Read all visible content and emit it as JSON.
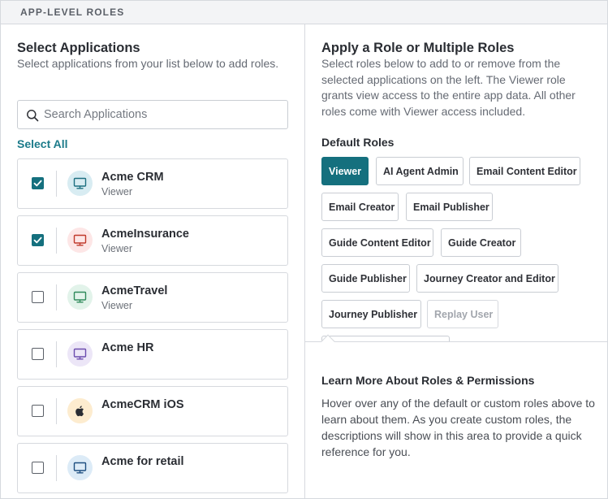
{
  "header": {
    "title": "APP-LEVEL ROLES"
  },
  "left": {
    "title": "Select Applications",
    "description": "Select applications from your list below to add roles.",
    "search": {
      "placeholder": "Search Applications",
      "value": ""
    },
    "select_all_label": "Select All",
    "apps": [
      {
        "name": "Acme CRM",
        "role": "Viewer",
        "checked": true,
        "icon": "monitor-icon",
        "avatar_bg": "#d8ecf2",
        "icon_color": "#1c6f80"
      },
      {
        "name": "AcmeInsurance",
        "role": "Viewer",
        "checked": true,
        "icon": "monitor-icon",
        "avatar_bg": "#fde6e6",
        "icon_color": "#c0392b"
      },
      {
        "name": "AcmeTravel",
        "role": "Viewer",
        "checked": false,
        "icon": "monitor-icon",
        "avatar_bg": "#e2f3ea",
        "icon_color": "#2e8a5a"
      },
      {
        "name": "Acme HR",
        "role": "",
        "checked": false,
        "icon": "monitor-icon",
        "avatar_bg": "#ece6f7",
        "icon_color": "#6b4cae"
      },
      {
        "name": "AcmeCRM iOS",
        "role": "",
        "checked": false,
        "icon": "apple-icon",
        "avatar_bg": "#fdeccf",
        "icon_color": "#2a2d33"
      },
      {
        "name": "Acme for retail",
        "role": "",
        "checked": false,
        "icon": "monitor-icon",
        "avatar_bg": "#dcebf7",
        "icon_color": "#1c4e80"
      }
    ]
  },
  "right": {
    "title": "Apply a Role or Multiple Roles",
    "description": "Select roles below to add to or remove from the selected applications on the left. The Viewer role grants view access to the entire app data. All other roles come with Viewer access included.",
    "default_roles_label": "Default Roles",
    "roles": [
      {
        "label": "Viewer",
        "state": "active"
      },
      {
        "label": "AI Agent Admin",
        "state": "normal"
      },
      {
        "label": "Email Content Editor",
        "state": "normal"
      },
      {
        "label": "Email Creator",
        "state": "normal"
      },
      {
        "label": "Email Publisher",
        "state": "normal"
      },
      {
        "label": "Guide Content Editor",
        "state": "normal"
      },
      {
        "label": "Guide Creator",
        "state": "normal"
      },
      {
        "label": "Guide Publisher",
        "state": "normal"
      },
      {
        "label": "Journey Creator and Editor",
        "state": "normal"
      },
      {
        "label": "Journey Publisher",
        "state": "normal"
      },
      {
        "label": "Replay User",
        "state": "disabled"
      }
    ],
    "info": {
      "title": "Learn More About Roles & Permissions",
      "text": "Hover over any of the default or custom roles above to learn about them. As you create custom roles, the descriptions will show in this area to provide a quick reference for you."
    }
  },
  "colors": {
    "accent": "#15707e",
    "link": "#1c7b8a",
    "border": "#d6d9de"
  }
}
